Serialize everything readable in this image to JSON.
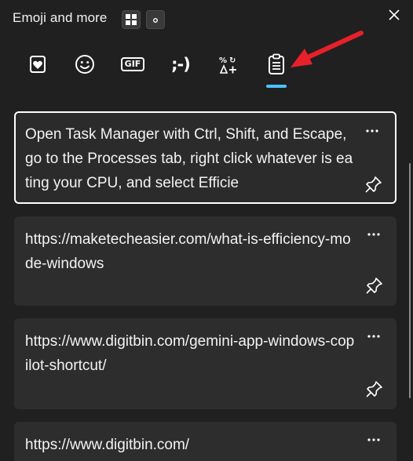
{
  "header": {
    "title": "Emoji and more"
  },
  "tabs": [
    {
      "name": "favorites",
      "icon": "heart-favorites-icon"
    },
    {
      "name": "emoji",
      "icon": "smiley-icon"
    },
    {
      "name": "gif",
      "icon": "gif-icon",
      "label": "GIF"
    },
    {
      "name": "kaomoji",
      "icon": "kaomoji-icon",
      "label": ";-)"
    },
    {
      "name": "symbols",
      "icon": "symbols-icon"
    },
    {
      "name": "clipboard",
      "icon": "clipboard-icon",
      "selected": true
    }
  ],
  "accent_color": "#4cc2ff",
  "annotation_arrow_color": "#e8202a",
  "clipboard_items": [
    {
      "text": "Open Task Manager with Ctrl, Shift, and Escape, go to the Processes tab, right click whatever is eating your CPU, and select Efficie",
      "selected": true
    },
    {
      "text": "https://maketecheasier.com/what-is-efficiency-mode-windows",
      "selected": false
    },
    {
      "text": "https://www.digitbin.com/gemini-app-windows-copilot-shortcut/",
      "selected": false
    },
    {
      "text": "https://www.digitbin.com/",
      "selected": false
    }
  ]
}
